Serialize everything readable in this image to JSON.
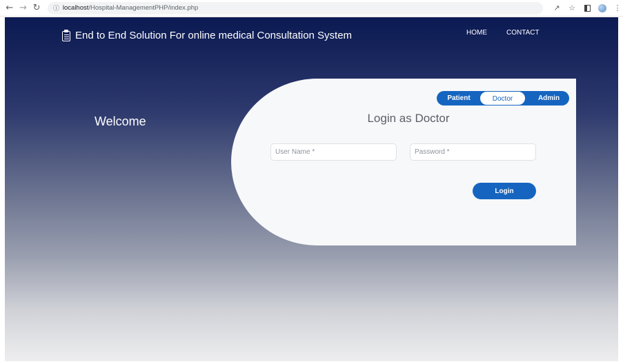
{
  "browser": {
    "url_host": "localhost",
    "url_path": "/Hospital-ManagementPHP/index.php"
  },
  "header": {
    "title": "End to End Solution For online medical Consultation System",
    "nav": [
      "HOME",
      "CONTACT"
    ]
  },
  "welcome": "Welcome",
  "login_card": {
    "tabs": [
      {
        "label": "Patient",
        "active": false
      },
      {
        "label": "Doctor",
        "active": true
      },
      {
        "label": "Admin",
        "active": false
      }
    ],
    "title": "Login as Doctor",
    "username_placeholder": "User Name *",
    "username_value": "",
    "password_placeholder": "Password *",
    "password_value": "",
    "submit_label": "Login"
  },
  "colors": {
    "accent": "#1565c0",
    "header_bg": "#0b1a52",
    "card_bg": "#f7f8fa"
  },
  "icons": [
    "back-arrow-icon",
    "forward-arrow-icon",
    "reload-icon",
    "site-info-icon",
    "share-icon",
    "bookmark-star-icon",
    "side-panel-icon",
    "extension-icon",
    "menu-dots-icon",
    "clipboard-medical-icon"
  ]
}
